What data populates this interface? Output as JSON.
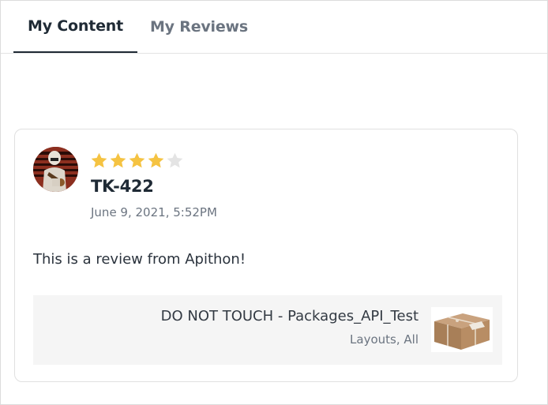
{
  "tabs": [
    {
      "label": "My Content",
      "active": true
    },
    {
      "label": "My Reviews",
      "active": false
    }
  ],
  "review": {
    "rating": 4,
    "max_rating": 5,
    "reviewer": "TK-422",
    "date": "June 9, 2021, 5:52PM",
    "text": "This is a review from Apithon!",
    "product": {
      "title": "DO NOT TOUCH - Packages_API_Test",
      "categories": "Layouts, All",
      "thumbnail_icon": "package-icon"
    }
  },
  "colors": {
    "star_filled": "#f5c342",
    "star_empty": "#e4e4e4",
    "text_primary": "#1f2a35",
    "text_secondary": "#6b7480"
  }
}
